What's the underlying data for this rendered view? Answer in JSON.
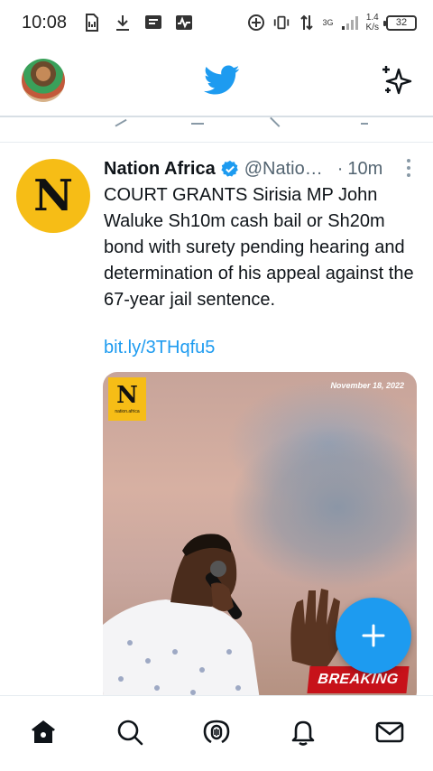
{
  "status_bar": {
    "time": "10:08",
    "network_type": "3G",
    "net_speed_value": "1.4",
    "net_speed_unit": "K/s",
    "battery": "32"
  },
  "app_bar": {
    "logo_icon": "twitter-bird-icon",
    "right_icon": "sparkle-icon",
    "accent_color": "#1d9bf0"
  },
  "tweet": {
    "author_name": "Nation Africa",
    "verified_icon": "verified-badge-icon",
    "handle": "@Natio…",
    "separator": "·",
    "time": "10m",
    "avatar_letter": "N",
    "text": "COURT GRANTS Sirisia MP John Waluke Sh10m cash bail or Sh20m bond with surety pending hearing and determination of his appeal against the 67-year jail sentence.",
    "link": "bit.ly/3THqfu5",
    "media": {
      "logo_letter": "N",
      "logo_caption": "nation.africa",
      "date": "November 18, 2022",
      "banner": "BREAKING"
    }
  },
  "bottom_nav": {
    "items": [
      "home-icon",
      "search-icon",
      "spaces-icon",
      "notifications-icon",
      "messages-icon"
    ]
  }
}
